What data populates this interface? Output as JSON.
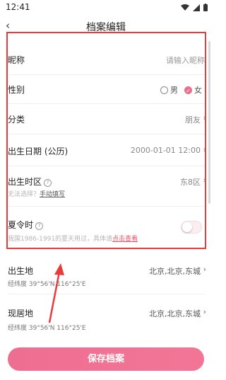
{
  "status_bar": {
    "time": "12:41"
  },
  "nav": {
    "back_icon": "‹",
    "title": "档案编辑"
  },
  "form": {
    "nickname": {
      "label": "昵称",
      "placeholder": "请输入昵称"
    },
    "gender": {
      "label": "性别",
      "options": [
        "男",
        "女"
      ],
      "selected": "女"
    },
    "category": {
      "label": "分类",
      "value": "朋友"
    },
    "birth_date": {
      "label": "出生日期 (公历)",
      "value": "2000-01-01 12:00"
    },
    "birth_timezone": {
      "label": "出生时区",
      "value": "东8区",
      "hint_prefix": "无法选择？",
      "hint_link": "手动填写"
    },
    "dst": {
      "label": "夏令时",
      "hint_prefix": "我国1986-1991的夏天用过，具体请",
      "hint_link": "点击查看",
      "enabled": false
    },
    "birthplace": {
      "label": "出生地",
      "value": "北京,北京,东城",
      "coords": "经纬度 39°56'N 116°25'E"
    },
    "residence": {
      "label": "现居地",
      "value": "北京,北京,东城",
      "coords": "经纬度 39°56'N 116°25'E"
    }
  },
  "save_button": {
    "label": "保存档案"
  },
  "colors": {
    "accent": "#ee6e92",
    "annotation": "#e83b3b"
  }
}
